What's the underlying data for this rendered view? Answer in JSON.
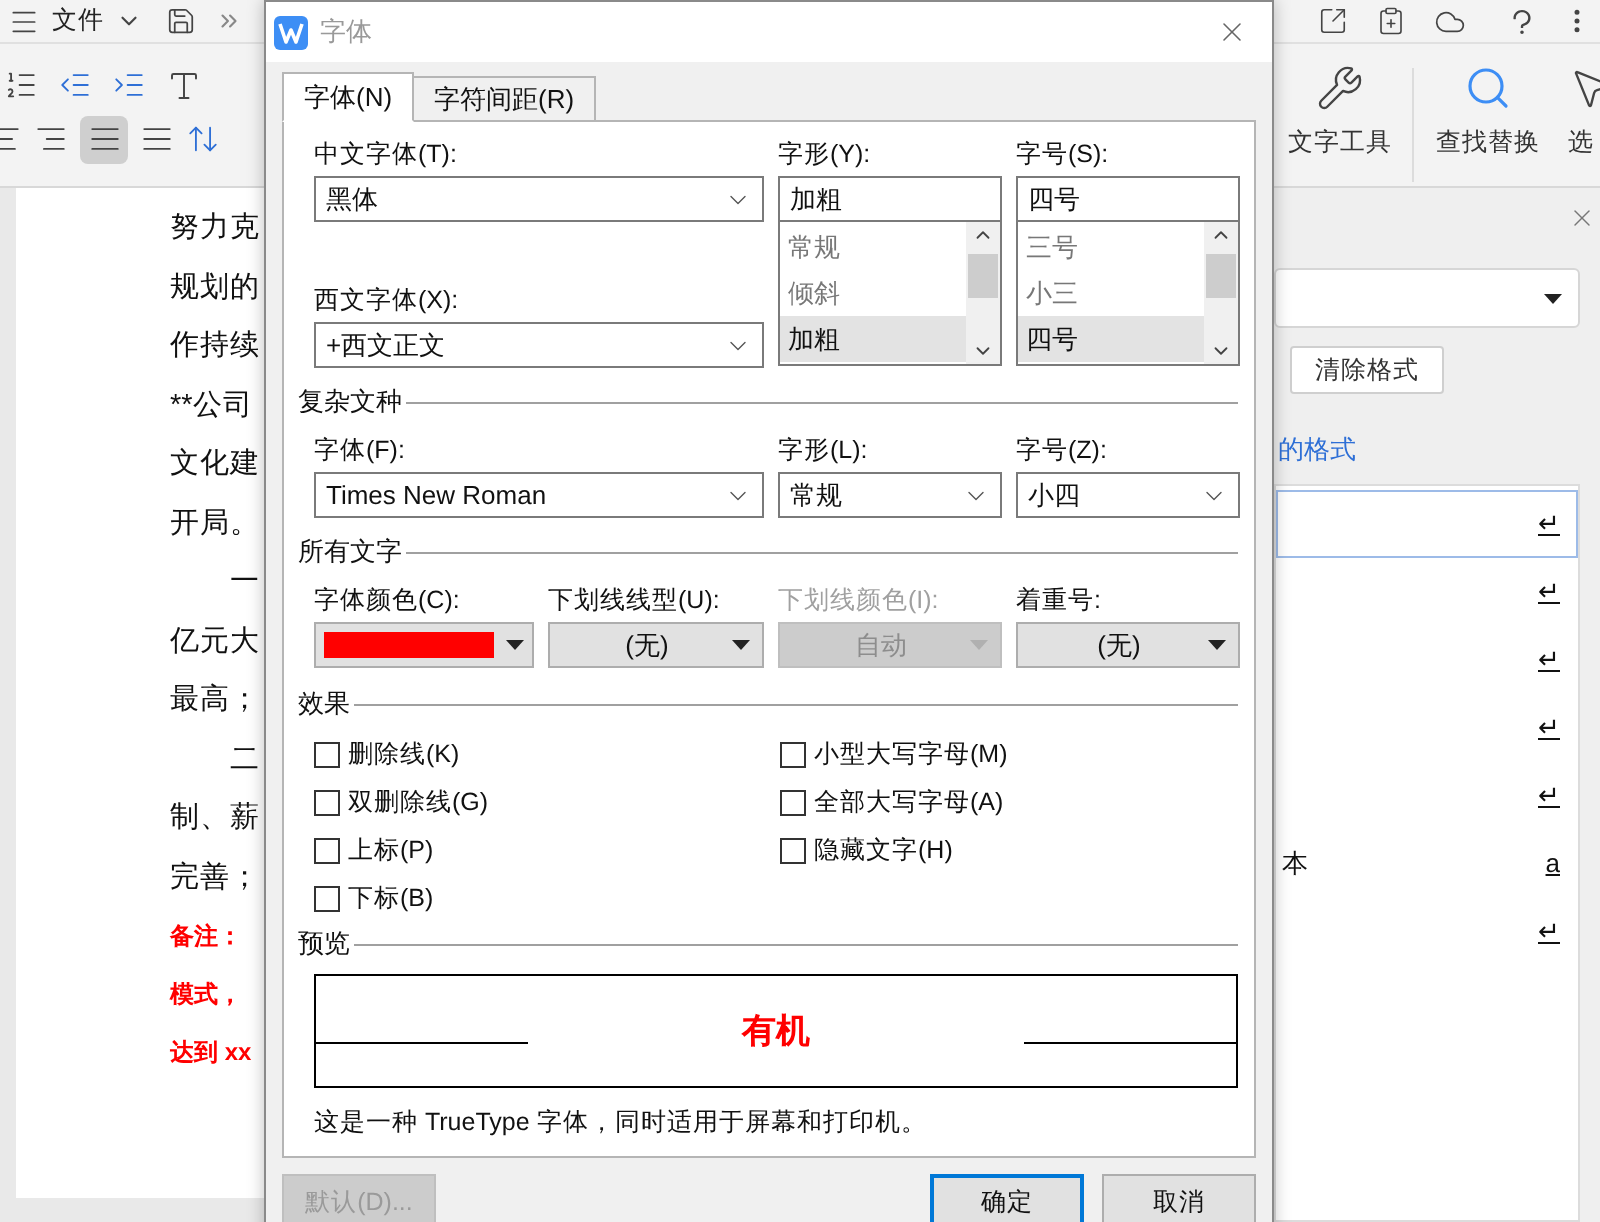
{
  "app_bar": {
    "menu_label": "文件"
  },
  "ribbon": {
    "tools": [
      {
        "label": "文字工具"
      },
      {
        "label": "查找替换"
      },
      {
        "label": "选"
      }
    ]
  },
  "document": {
    "lines": [
      {
        "text": "努力克",
        "kind": "body"
      },
      {
        "text": "规划的",
        "kind": "body"
      },
      {
        "text": "作持续",
        "kind": "body"
      },
      {
        "text": "**公司",
        "kind": "body"
      },
      {
        "text": "文化建",
        "kind": "body"
      },
      {
        "text": "开局。",
        "kind": "body"
      },
      {
        "text": "一",
        "kind": "indent"
      },
      {
        "text": "亿元大",
        "kind": "body"
      },
      {
        "text": "最高；",
        "kind": "body"
      },
      {
        "text": "二",
        "kind": "indent"
      },
      {
        "text": "制、薪",
        "kind": "body"
      },
      {
        "text": "完善；",
        "kind": "body"
      },
      {
        "text": "备注：",
        "kind": "note"
      },
      {
        "text": "模式，",
        "kind": "note"
      },
      {
        "text": "达到 xx",
        "kind": "note"
      }
    ]
  },
  "side_pane": {
    "clear_button": "清除格式",
    "link": "的格式",
    "rows": [
      {
        "left": "",
        "right": "↵",
        "selected": true
      },
      {
        "left": "",
        "right": "↵",
        "selected": false
      },
      {
        "left": "",
        "right": "↵",
        "selected": false
      },
      {
        "left": "",
        "right": "↵",
        "selected": false
      },
      {
        "left": "",
        "right": "↵",
        "selected": false
      },
      {
        "left": "本",
        "right": "a",
        "selected": false
      },
      {
        "left": "",
        "right": "↵",
        "selected": false
      }
    ]
  },
  "dialog": {
    "title": "字体",
    "tabs": [
      {
        "label": "字体(N)",
        "selected": true
      },
      {
        "label": "字符间距(R)",
        "selected": false
      }
    ],
    "chinese_font": {
      "label": "中文字体(T):",
      "value": "黑体"
    },
    "western_font": {
      "label": "西文字体(X):",
      "value": "+西文正文"
    },
    "style": {
      "label": "字形(Y):",
      "value": "加粗",
      "options": [
        {
          "label": "常规",
          "selected": false
        },
        {
          "label": "倾斜",
          "selected": false
        },
        {
          "label": "加粗",
          "selected": true
        }
      ]
    },
    "size": {
      "label": "字号(S):",
      "value": "四号",
      "options": [
        {
          "label": "三号",
          "selected": false
        },
        {
          "label": "小三",
          "selected": false
        },
        {
          "label": "四号",
          "selected": true
        }
      ]
    },
    "complex": {
      "heading": "复杂文种",
      "fields": [
        {
          "label": "字体(F):",
          "value": "Times New Roman"
        },
        {
          "label": "字形(L):",
          "value": "常规"
        },
        {
          "label": "字号(Z):",
          "value": "小四"
        }
      ]
    },
    "all_text": {
      "heading": "所有文字",
      "fields": [
        {
          "label": "字体颜色(C):",
          "kind": "color",
          "color": "#ff0000",
          "disabled": false
        },
        {
          "label": "下划线线型(U):",
          "kind": "dropdown",
          "value": "(无)",
          "disabled": false
        },
        {
          "label": "下划线颜色(I):",
          "kind": "dropdown",
          "value": "自动",
          "disabled": true
        },
        {
          "label": "着重号:",
          "kind": "dropdown",
          "value": "(无)",
          "disabled": false
        }
      ]
    },
    "effects": {
      "heading": "效果",
      "options": [
        {
          "label": "删除线(K)",
          "checked": false
        },
        {
          "label": "双删除线(G)",
          "checked": false
        },
        {
          "label": "上标(P)",
          "checked": false
        },
        {
          "label": "下标(B)",
          "checked": false
        },
        {
          "label": "小型大写字母(M)",
          "checked": false
        },
        {
          "label": "全部大写字母(A)",
          "checked": false
        },
        {
          "label": "隐藏文字(H)",
          "checked": false
        }
      ]
    },
    "preview": {
      "heading": "预览",
      "sample": "有机"
    },
    "note": "这是一种 TrueType 字体，同时适用于屏幕和打印机。",
    "buttons": [
      {
        "label": "默认(D)...",
        "disabled": true,
        "default": false
      },
      {
        "label": "确定",
        "disabled": false,
        "default": true
      },
      {
        "label": "取消",
        "disabled": false,
        "default": false
      }
    ]
  }
}
